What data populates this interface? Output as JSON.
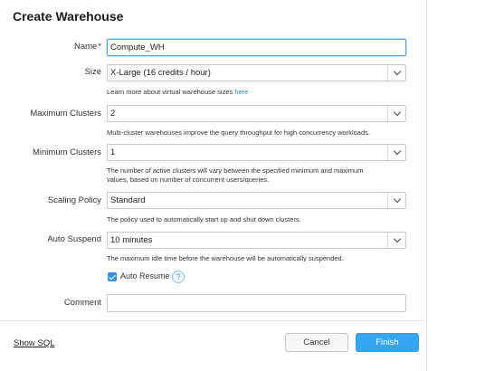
{
  "dialog": {
    "title": "Create Warehouse",
    "fields": {
      "name": {
        "label": "Name",
        "required_mark": "*",
        "value": "Compute_WH"
      },
      "size": {
        "label": "Size",
        "value": "X-Large  (16 credits / hour)",
        "help_text": "Learn more about virtual warehouse sizes ",
        "help_link": "here"
      },
      "max_clusters": {
        "label": "Maximum Clusters",
        "value": "2",
        "help_text": "Multi-cluster warehouses improve the query throughput for high concurrency workloads."
      },
      "min_clusters": {
        "label": "Minimum Clusters",
        "value": "1",
        "help_text_line1": "The number of active clusters will vary between the specified minimum and maximum",
        "help_text_line2": "values, based on number of concurrent users/queries."
      },
      "scaling_policy": {
        "label": "Scaling Policy",
        "value": "Standard",
        "help_text": "The policy used to automatically start up and shut down clusters."
      },
      "auto_suspend": {
        "label": "Auto Suspend",
        "value": "10 minutes",
        "help_text": "The maximum idle time before the warehouse will be automatically suspended."
      },
      "auto_resume": {
        "label": "Auto Resume",
        "checked": true,
        "help_icon": "?"
      },
      "comment": {
        "label": "Comment",
        "value": ""
      }
    },
    "footer": {
      "show_sql": "Show SQL",
      "cancel": "Cancel",
      "finish": "Finish"
    }
  },
  "colors": {
    "accent": "#34a6f4",
    "link": "#2f7fc6",
    "focus_border": "#5a9fd8"
  }
}
